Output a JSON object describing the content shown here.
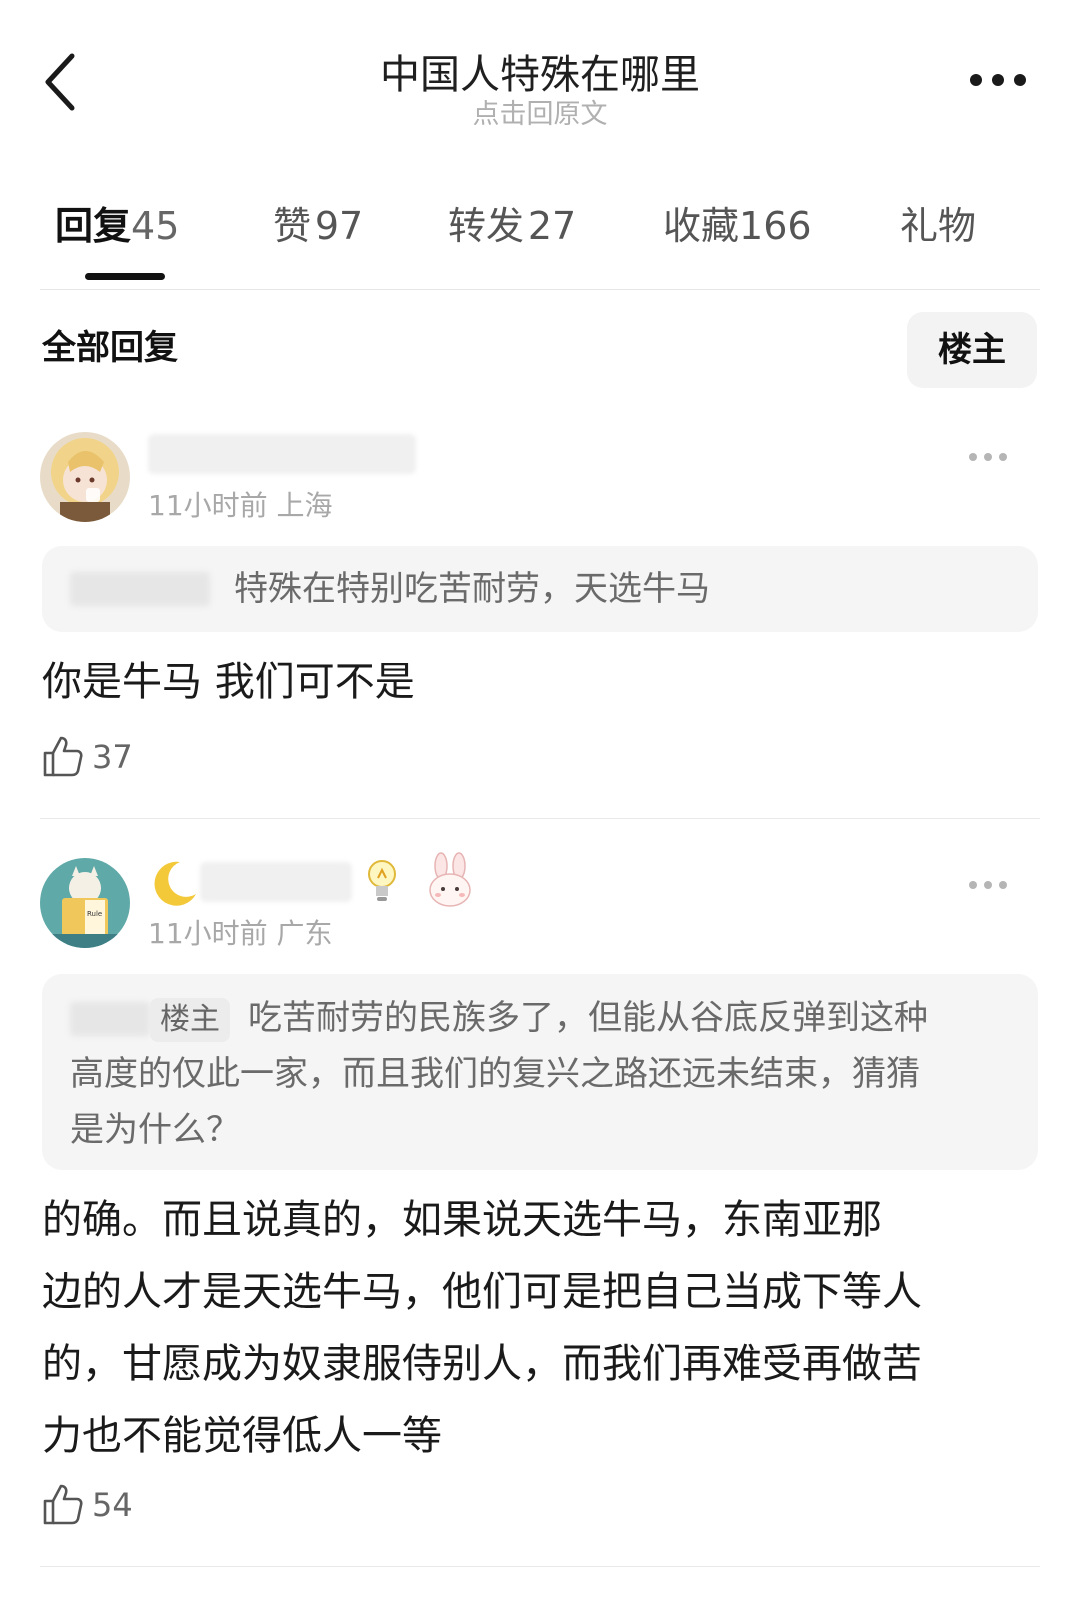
{
  "header": {
    "title": "中国人特殊在哪里",
    "subtitle": "点击回原文"
  },
  "tabs": [
    {
      "label": "回复",
      "count": "45"
    },
    {
      "label": "赞",
      "count": "97"
    },
    {
      "label": "转发",
      "count": "27"
    },
    {
      "label": "收藏",
      "count": "166"
    },
    {
      "label": "礼物",
      "count": ""
    }
  ],
  "filter": {
    "all_replies": "全部回复",
    "op_only": "楼主"
  },
  "comments": [
    {
      "meta": "11小时前 上海",
      "quote": "特殊在特别吃苦耐劳，天选牛马",
      "body": "你是牛马 我们可不是",
      "likes": "37"
    },
    {
      "meta": "11小时前 广东",
      "quote_tag": "楼主",
      "quote_line1": "吃苦耐劳的民族多了，但能从谷底反弹到这种",
      "quote_line2": "高度的仅此一家，而且我们的复兴之路还远未结束，猜猜",
      "quote_line3": "是为什么？",
      "body_line1": "的确。而且说真的，如果说天选牛马，东南亚那",
      "body_line2": "边的人才是天选牛马，他们可是把自己当成下等人",
      "body_line3": "的，甘愿成为奴隶服侍别人，而我们再难受再做苦",
      "body_line4": "力也不能觉得低人一等",
      "likes": "54",
      "badges": [
        "moon-icon",
        "lightbulb-icon",
        "rabbit-icon"
      ]
    }
  ],
  "colors": {
    "text_primary": "#1a1a1a",
    "text_secondary": "#a8a8a8",
    "quote_bg": "#f5f5f5",
    "underline": "#111111"
  }
}
